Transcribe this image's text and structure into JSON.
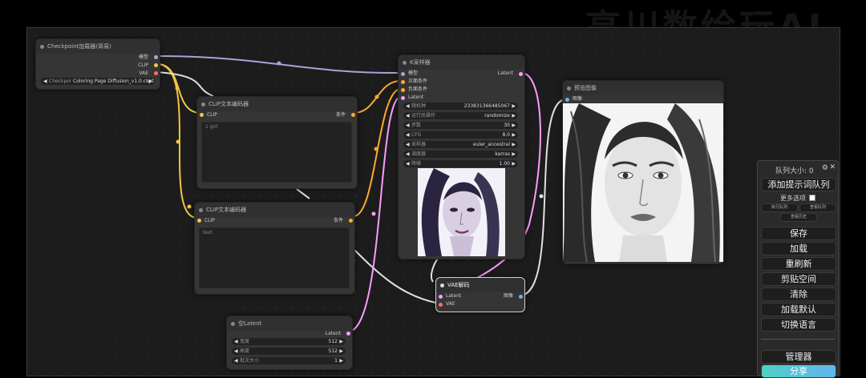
{
  "watermark": "高川数绘玩AI",
  "nodes": {
    "checkpoint": {
      "title": "Checkpoint加载器(简易)",
      "outputs": [
        "模型",
        "CLIP",
        "VAE"
      ],
      "ckpt_label": "Checkpoi",
      "ckpt_value": "Coloring Page Diffusion_v1.0.ckpt"
    },
    "clip1": {
      "title": "CLIP文本编码器",
      "input": "CLIP",
      "output": "条件",
      "text": "1 girl"
    },
    "clip2": {
      "title": "CLIP文本编码器",
      "input": "CLIP",
      "output": "条件",
      "text": "text"
    },
    "ksampler": {
      "title": "K采样器",
      "inputs": [
        "模型",
        "正面条件",
        "负面条件",
        "Latent"
      ],
      "output": "Latent",
      "widgets": [
        {
          "label": "随机种",
          "value": "233831366485067"
        },
        {
          "label": "运行后操作",
          "value": "randomize"
        },
        {
          "label": "步数",
          "value": "30"
        },
        {
          "label": "CFG",
          "value": "8.0"
        },
        {
          "label": "采样器",
          "value": "euler_ancestral"
        },
        {
          "label": "调度器",
          "value": "karras"
        },
        {
          "label": "降噪",
          "value": "1.00"
        }
      ]
    },
    "vae": {
      "title": "VAE解码",
      "inputs": [
        "Latent",
        "VAE"
      ],
      "output": "图像"
    },
    "latent": {
      "title": "空Latent",
      "output": "Latent",
      "widgets": [
        {
          "label": "宽度",
          "value": "512"
        },
        {
          "label": "高度",
          "value": "512"
        },
        {
          "label": "批次大小",
          "value": "1"
        }
      ]
    },
    "preview": {
      "title": "预览图像",
      "input": "图像"
    }
  },
  "queue_panel": {
    "title": "队列大小: 0",
    "queue_button": "添加提示词队列",
    "more_options": "更多选项",
    "small_buttons": [
      "执行队列",
      "查看队列",
      "查看历史"
    ],
    "buttons": [
      "保存",
      "加载",
      "重刷新",
      "剪贴空间",
      "清除",
      "加载默认",
      "切换语言"
    ],
    "manager": "管理器",
    "share": "分享"
  },
  "colors": {
    "model_wire": "#b39ddb",
    "clip_wire": "#f6c343",
    "conditioning_wire": "#ffa931",
    "latent_wire": "#ff9cf9",
    "vae_wire": "#ff6e6e",
    "image_wire": "#64b5f6"
  }
}
